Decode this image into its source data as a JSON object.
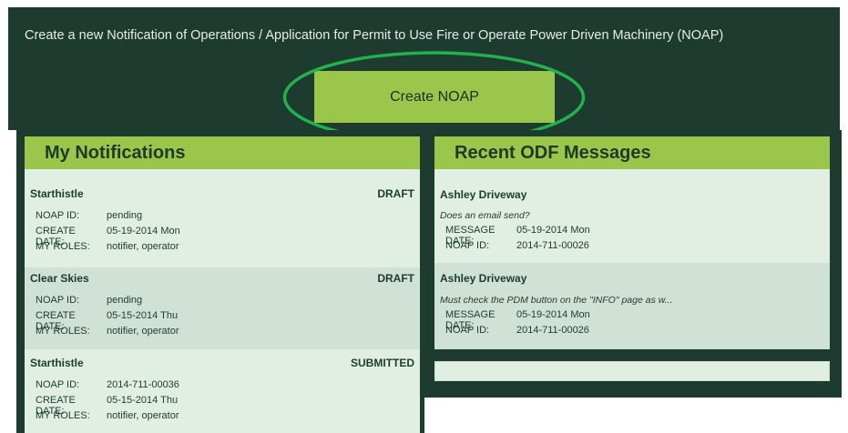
{
  "banner": {
    "text": "Create a new Notification of Operations / Application for Permit to Use Fire or Operate Power Driven Machinery (NOAP)",
    "button_label": "Create NOAP"
  },
  "colors": {
    "banner_bg": "#1e3b30",
    "accent_green": "#9ac64c",
    "panel_bg": "#e1eee2",
    "highlight_ring": "#22b14c"
  },
  "notifications": {
    "title": "My Notifications",
    "labels": {
      "noap_id": "NOAP ID:",
      "create_date": "CREATE DATE:",
      "my_roles": "MY ROLES:"
    },
    "items": [
      {
        "name": "Starthistle",
        "status": "DRAFT",
        "noap_id": "pending",
        "create_date": "05-19-2014 Mon",
        "roles": "notifier, operator"
      },
      {
        "name": "Clear Skies",
        "status": "DRAFT",
        "noap_id": "pending",
        "create_date": "05-15-2014 Thu",
        "roles": "notifier, operator"
      },
      {
        "name": "Starthistle",
        "status": "SUBMITTED",
        "noap_id": "2014-711-00036",
        "create_date": "05-15-2014 Thu",
        "roles": "notifier, operator"
      }
    ]
  },
  "messages": {
    "title": "Recent ODF Messages",
    "labels": {
      "message_date": "MESSAGE DATE:",
      "noap_id": "NOAP ID:"
    },
    "items": [
      {
        "sender": "Ashley Driveway",
        "note": "Does an email send?",
        "message_date": "05-19-2014 Mon",
        "noap_id": "2014-711-00026"
      },
      {
        "sender": "Ashley Driveway",
        "note": "Must check the PDM button on the \"INFO\" page as w...",
        "message_date": "05-19-2014 Mon",
        "noap_id": "2014-711-00026"
      }
    ]
  }
}
